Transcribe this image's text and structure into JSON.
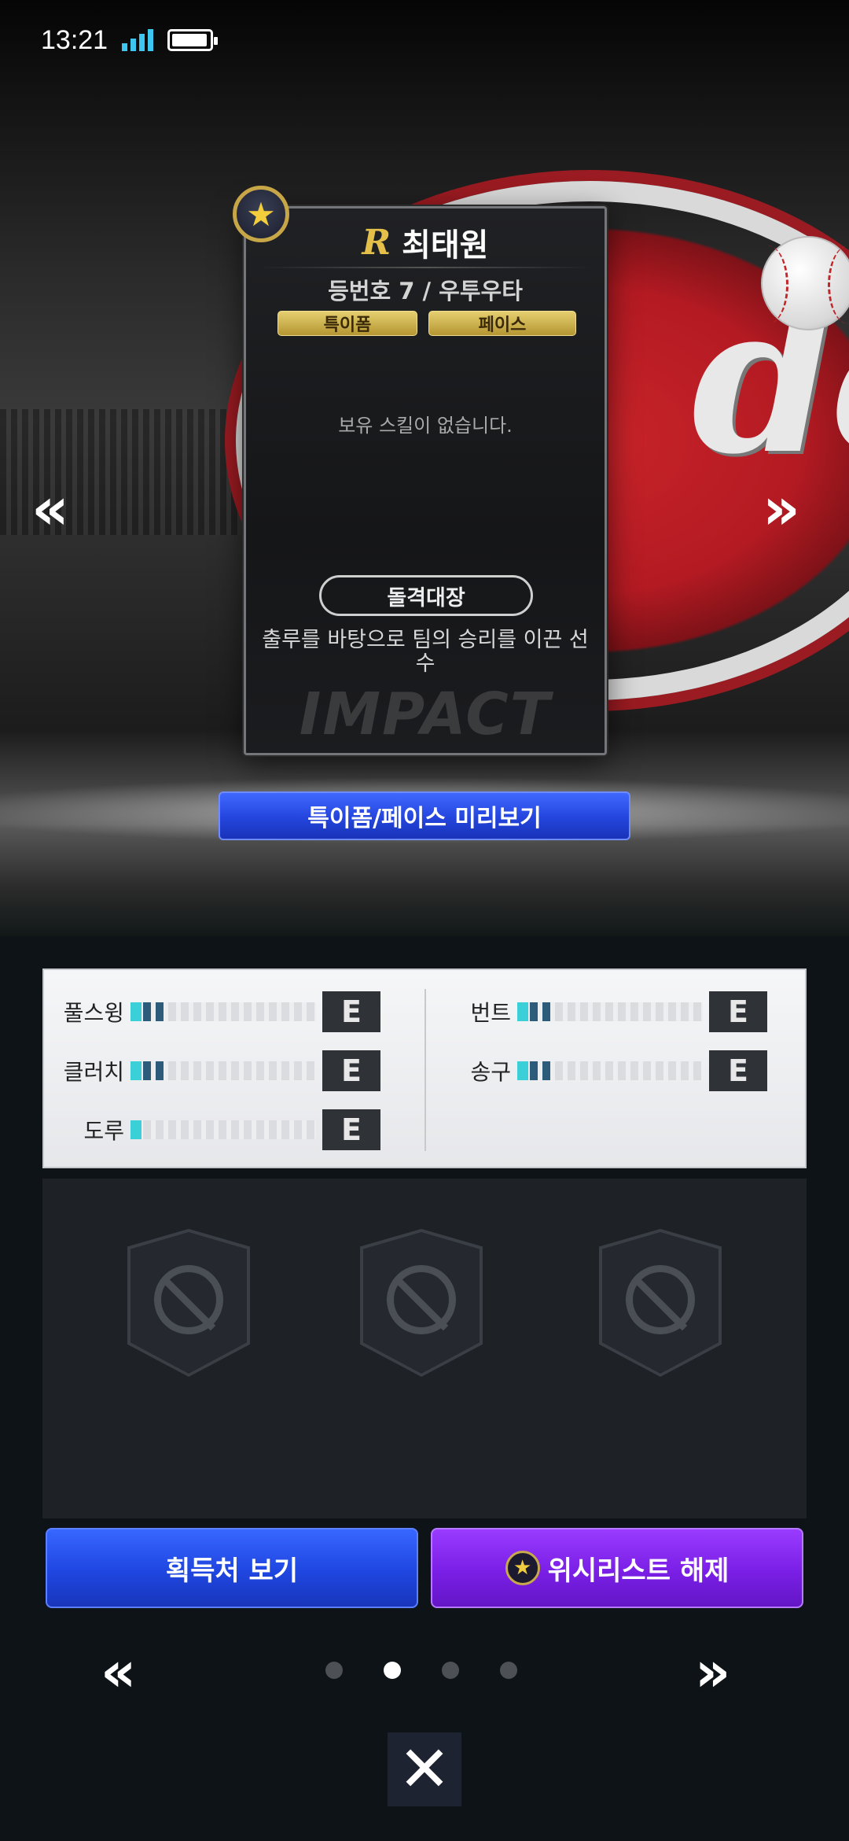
{
  "status_bar": {
    "time": "13:21",
    "battery_level": 0.95,
    "signal_bars": 4
  },
  "player_card": {
    "name": "최태원",
    "number_position": "등번호 7 / 우투우타",
    "tags": {
      "uniform": "특이폼",
      "face": "페이스"
    },
    "no_skill_text": "보유 스킬이 없습니다.",
    "role": "돌격대장",
    "role_description": "출루를 바탕으로 팀의 승리를 이끈 선수",
    "watermark": "IMPACT",
    "badge_icon": "star-icon"
  },
  "preview_button": "특이폼/페이스 미리보기",
  "stats": {
    "left": [
      {
        "label": "풀스윙",
        "grade": "E",
        "level": 0.18
      },
      {
        "label": "클러치",
        "grade": "E",
        "level": 0.18
      },
      {
        "label": "도루",
        "grade": "E",
        "level": 0.06
      }
    ],
    "right": [
      {
        "label": "번트",
        "grade": "E",
        "level": 0.18
      },
      {
        "label": "송구",
        "grade": "E",
        "level": 0.18
      }
    ]
  },
  "skill_slots": [
    {
      "state": "locked",
      "icon": "ban-icon"
    },
    {
      "state": "locked",
      "icon": "ban-icon"
    },
    {
      "state": "locked",
      "icon": "ban-icon"
    }
  ],
  "buttons": {
    "obtain": "획득처 보기",
    "wishlist": "위시리스트 해제"
  },
  "pager": {
    "total": 4,
    "current": 2
  },
  "icons": {
    "prev": "«",
    "next": "»",
    "close": "✕",
    "star": "★"
  },
  "colors": {
    "primary_blue": "#2445dd",
    "wish_purple": "#7a1fe6",
    "gold": "#c7a648"
  }
}
